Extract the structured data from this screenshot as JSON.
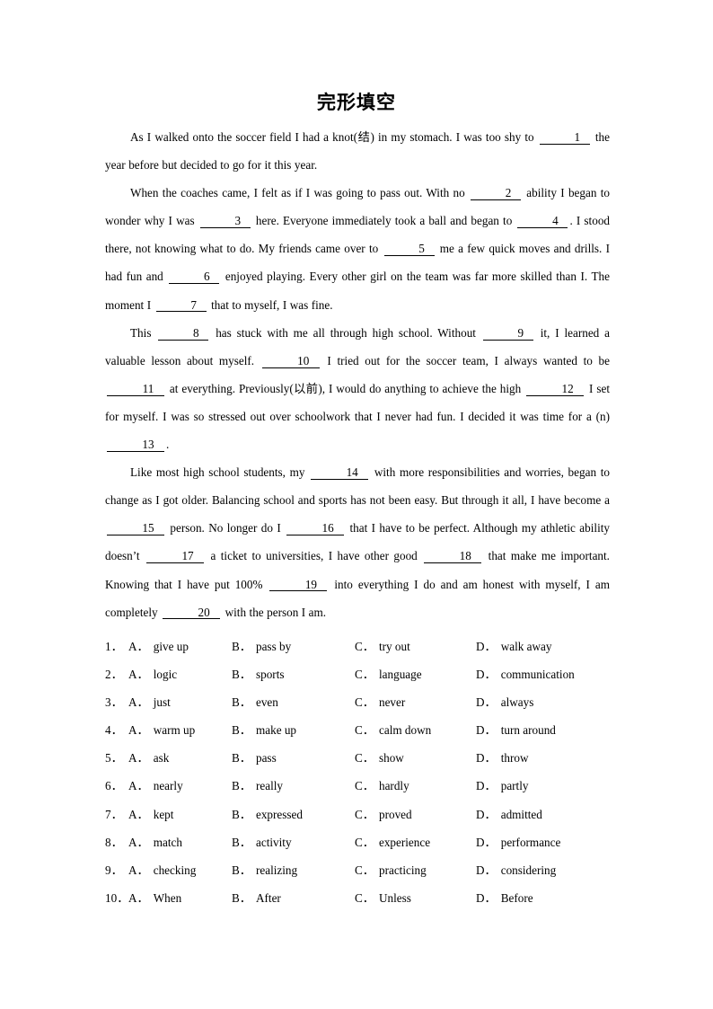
{
  "document": {
    "title": "完形填空"
  },
  "passage": {
    "paragraphs": [
      {
        "id": "p1",
        "segments": [
          {
            "type": "text",
            "value": "As I walked onto the soccer field I had a knot(结) in my stomach. I was too shy to "
          },
          {
            "type": "blank",
            "value": "1"
          },
          {
            "type": "text",
            "value": " the year before but decided to go for it this year."
          }
        ]
      },
      {
        "id": "p2",
        "segments": [
          {
            "type": "text",
            "value": "When the coaches came, I felt as if I was going to pass out. With no "
          },
          {
            "type": "blank",
            "value": "2"
          },
          {
            "type": "text",
            "value": " ability I began to wonder why I was "
          },
          {
            "type": "blank",
            "value": "3"
          },
          {
            "type": "text",
            "value": " here. Everyone immediately took a ball and began to "
          },
          {
            "type": "blank",
            "value": "4"
          },
          {
            "type": "text",
            "value": ". I stood there, not knowing what to do. My friends came over to "
          },
          {
            "type": "blank",
            "value": "5"
          },
          {
            "type": "text",
            "value": " me a few quick moves and drills. I had fun and "
          },
          {
            "type": "blank",
            "value": "6"
          },
          {
            "type": "text",
            "value": " enjoyed playing. Every other girl on the team was far more skilled than I. The moment I "
          },
          {
            "type": "blank",
            "value": "7"
          },
          {
            "type": "text",
            "value": " that to myself, I was fine."
          }
        ]
      },
      {
        "id": "p3",
        "segments": [
          {
            "type": "text",
            "value": "This "
          },
          {
            "type": "blank",
            "value": "8"
          },
          {
            "type": "text",
            "value": " has stuck with me all through high school. Without "
          },
          {
            "type": "blank",
            "value": "9"
          },
          {
            "type": "text",
            "value": " it, I learned a valuable lesson about myself. "
          },
          {
            "type": "blank",
            "value": "10"
          },
          {
            "type": "text",
            "value": " I tried out for the soccer team, I always wanted to be "
          },
          {
            "type": "blank",
            "value": "11"
          },
          {
            "type": "text",
            "value": " at everything. Previously(以前), I would do anything to achieve the high "
          },
          {
            "type": "blank",
            "value": "12"
          },
          {
            "type": "text",
            "value": " I set for myself. I was so stressed out over schoolwork that I never had fun. I decided it was time for a (n) "
          },
          {
            "type": "blank",
            "value": "13"
          },
          {
            "type": "text",
            "value": "."
          }
        ]
      },
      {
        "id": "p4",
        "segments": [
          {
            "type": "text",
            "value": "Like most high school students, my "
          },
          {
            "type": "blank",
            "value": "14"
          },
          {
            "type": "text",
            "value": " with more responsibilities and worries, began to change as I got older. Balancing school and sports has not been easy. But through it all, I have become a "
          },
          {
            "type": "blank",
            "value": "15"
          },
          {
            "type": "text",
            "value": " person. No longer do I "
          },
          {
            "type": "blank",
            "value": "16"
          },
          {
            "type": "text",
            "value": " that I have to be perfect. Although my athletic ability doesn’t "
          },
          {
            "type": "blank",
            "value": "17"
          },
          {
            "type": "text",
            "value": " a ticket to universities, I have other good "
          },
          {
            "type": "blank",
            "value": "18"
          },
          {
            "type": "text",
            "value": " that make me important. Knowing that I have put 100% "
          },
          {
            "type": "blank",
            "value": "19"
          },
          {
            "type": "text",
            "value": " into everything I do and am honest with myself, I am completely "
          },
          {
            "type": "blank",
            "value": "20"
          },
          {
            "type": "text",
            "value": " with the person I am."
          }
        ]
      }
    ]
  },
  "questions": [
    {
      "number": "1．",
      "choices": [
        {
          "letter": "A．",
          "text": "give up"
        },
        {
          "letter": "B．",
          "text": "pass by"
        },
        {
          "letter": "C．",
          "text": "try out"
        },
        {
          "letter": "D．",
          "text": "walk away"
        }
      ]
    },
    {
      "number": "2．",
      "choices": [
        {
          "letter": "A．",
          "text": "logic"
        },
        {
          "letter": "B．",
          "text": "sports"
        },
        {
          "letter": "C．",
          "text": "language"
        },
        {
          "letter": "D．",
          "text": "communication"
        }
      ]
    },
    {
      "number": "3．",
      "choices": [
        {
          "letter": "A．",
          "text": "just"
        },
        {
          "letter": "B．",
          "text": "even"
        },
        {
          "letter": "C．",
          "text": "never"
        },
        {
          "letter": "D．",
          "text": "always"
        }
      ]
    },
    {
      "number": "4．",
      "choices": [
        {
          "letter": "A．",
          "text": "warm up"
        },
        {
          "letter": "B．",
          "text": "make up"
        },
        {
          "letter": "C．",
          "text": "calm down"
        },
        {
          "letter": "D．",
          "text": "turn around"
        }
      ]
    },
    {
      "number": "5．",
      "choices": [
        {
          "letter": "A．",
          "text": "ask"
        },
        {
          "letter": "B．",
          "text": "pass"
        },
        {
          "letter": "C．",
          "text": "show"
        },
        {
          "letter": "D．",
          "text": "throw"
        }
      ]
    },
    {
      "number": "6．",
      "choices": [
        {
          "letter": "A．",
          "text": "nearly"
        },
        {
          "letter": "B．",
          "text": "really"
        },
        {
          "letter": "C．",
          "text": "hardly"
        },
        {
          "letter": "D．",
          "text": "partly"
        }
      ]
    },
    {
      "number": "7．",
      "choices": [
        {
          "letter": "A．",
          "text": "kept"
        },
        {
          "letter": "B．",
          "text": "expressed"
        },
        {
          "letter": "C．",
          "text": "proved"
        },
        {
          "letter": "D．",
          "text": "admitted"
        }
      ]
    },
    {
      "number": "8．",
      "choices": [
        {
          "letter": "A．",
          "text": "match"
        },
        {
          "letter": "B．",
          "text": "activity"
        },
        {
          "letter": "C．",
          "text": "experience"
        },
        {
          "letter": "D．",
          "text": "performance"
        }
      ]
    },
    {
      "number": "9．",
      "choices": [
        {
          "letter": "A．",
          "text": "checking"
        },
        {
          "letter": "B．",
          "text": "realizing"
        },
        {
          "letter": "C．",
          "text": "practicing"
        },
        {
          "letter": "D．",
          "text": "considering"
        }
      ]
    },
    {
      "number": "10．",
      "choices": [
        {
          "letter": "A．",
          "text": "When"
        },
        {
          "letter": "B．",
          "text": "After"
        },
        {
          "letter": "C．",
          "text": "Unless"
        },
        {
          "letter": "D．",
          "text": "Before"
        }
      ]
    }
  ]
}
